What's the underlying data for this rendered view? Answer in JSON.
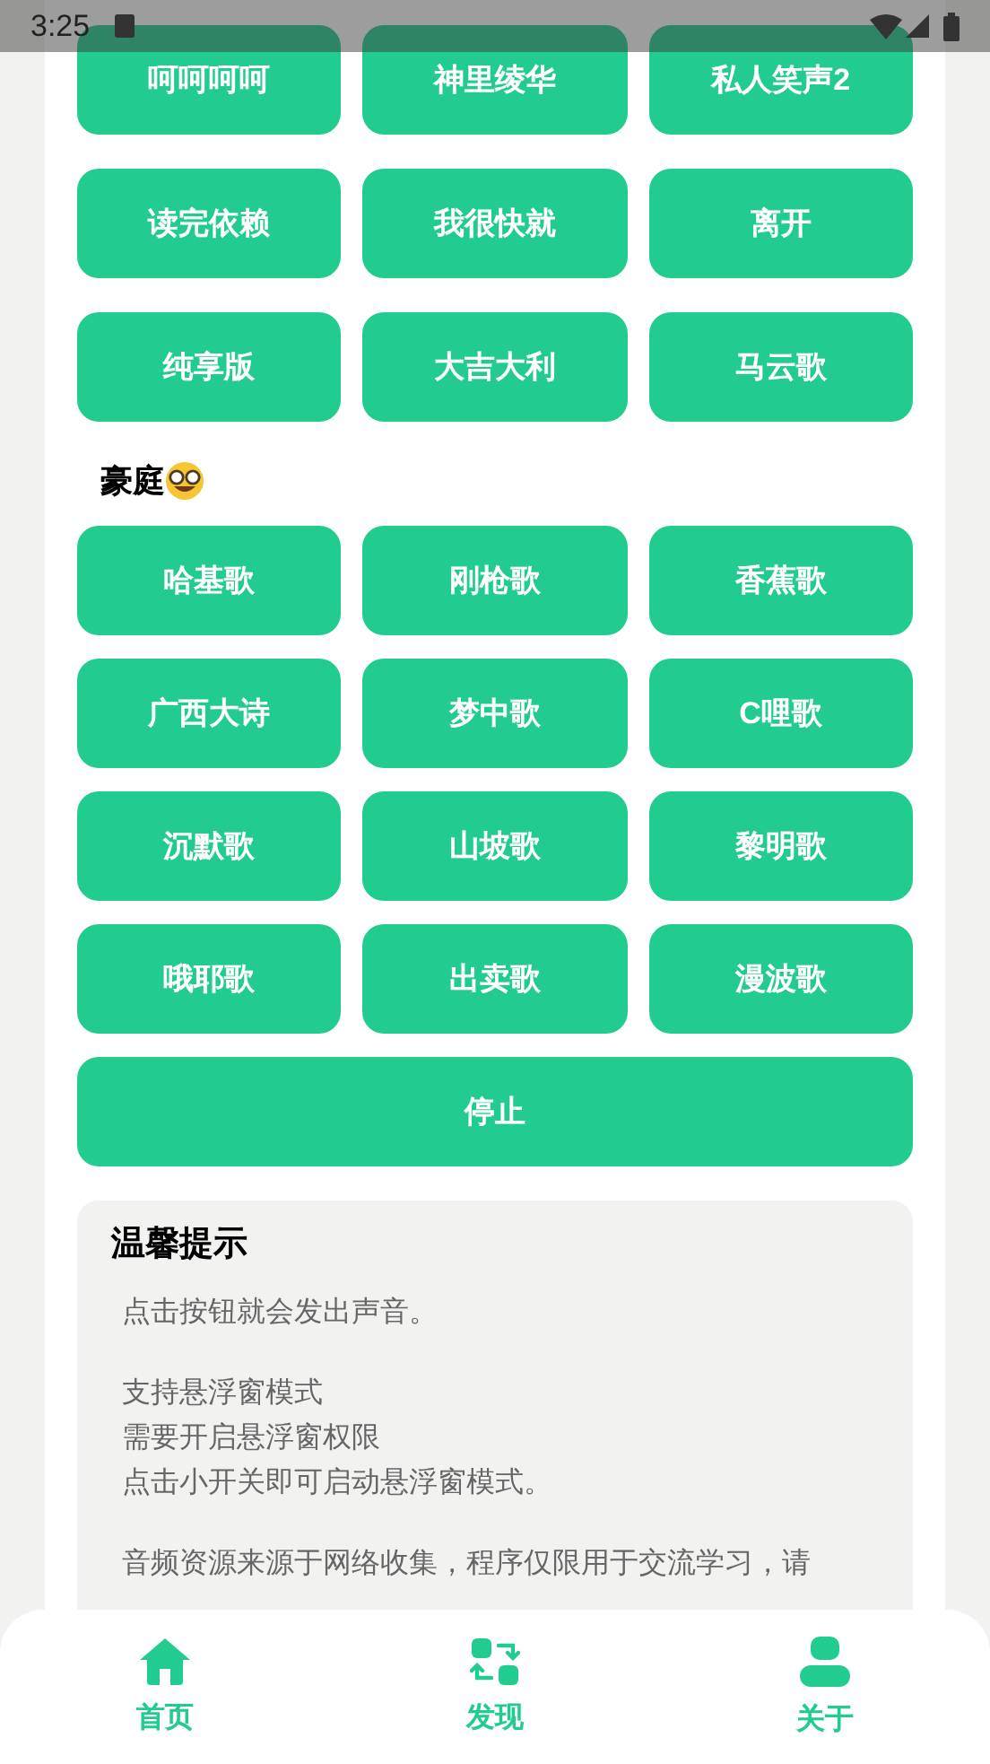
{
  "status_bar": {
    "time": "3:25"
  },
  "groups": [
    {
      "buttons": [
        "呵呵呵呵",
        "神里绫华",
        "私人笑声2",
        "读完依赖",
        "我很快就",
        "离开",
        "纯享版",
        "大吉大利",
        "马云歌"
      ]
    },
    {
      "heading": "豪庭",
      "buttons": [
        "哈基歌",
        "刚枪歌",
        "香蕉歌",
        "广西大诗",
        "梦中歌",
        "C哩歌",
        "沉默歌",
        "山坡歌",
        "黎明歌",
        "哦耶歌",
        "出卖歌",
        "漫波歌"
      ]
    }
  ],
  "stop_button": "停止",
  "tips": {
    "title": "温馨提示",
    "paragraphs": [
      [
        "点击按钮就会发出声音。"
      ],
      [
        "支持悬浮窗模式",
        "需要开启悬浮窗权限",
        "点击小开关即可启动悬浮窗模式。"
      ],
      [
        "音频资源来源于网络收集，程序仅限用于交流学习，请"
      ]
    ]
  },
  "nav": [
    {
      "kind": "home",
      "label": "首页"
    },
    {
      "kind": "discover",
      "label": "发现"
    },
    {
      "kind": "about",
      "label": "关于"
    }
  ]
}
